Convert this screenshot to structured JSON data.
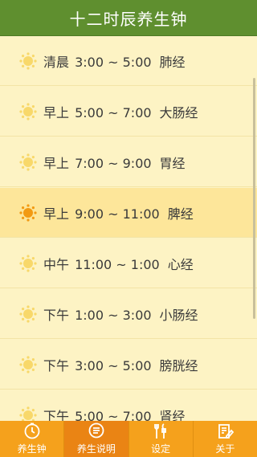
{
  "header": {
    "title": "十二时辰养生钟"
  },
  "list": {
    "items": [
      {
        "period": "清晨",
        "time": "3:00 ~ 5:00",
        "organ": "肺经",
        "active": false
      },
      {
        "period": "早上",
        "time": "5:00 ~ 7:00",
        "organ": "大肠经",
        "active": false
      },
      {
        "period": "早上",
        "time": "7:00 ~ 9:00",
        "organ": "胃经",
        "active": false
      },
      {
        "period": "早上",
        "time": "9:00 ~ 11:00",
        "organ": "脾经",
        "active": true
      },
      {
        "period": "中午",
        "time": "11:00 ~ 1:00",
        "organ": "心经",
        "active": false
      },
      {
        "period": "下午",
        "time": "1:00 ~ 3:00",
        "organ": "小肠经",
        "active": false
      },
      {
        "period": "下午",
        "time": "3:00 ~ 5:00",
        "organ": "膀胱经",
        "active": false
      },
      {
        "period": "下午",
        "time": "5:00 ~ 7:00",
        "organ": "肾经",
        "active": false
      }
    ],
    "icon": "sun-icon"
  },
  "tabs": [
    {
      "label": "养生钟",
      "icon": "clock-icon",
      "selected": false
    },
    {
      "label": "养生说明",
      "icon": "list-bubble-icon",
      "selected": true
    },
    {
      "label": "设定",
      "icon": "tools-icon",
      "selected": false
    },
    {
      "label": "关于",
      "icon": "document-edit-icon",
      "selected": false
    }
  ],
  "colors": {
    "title_bar": "#5f8f2f",
    "background": "#fdf3c4",
    "active_row": "#fde69a",
    "sun_light": "#f8d86a",
    "sun_active": "#f29a12",
    "tab_bar": "#f5a11c",
    "tab_selected": "#ea8414"
  }
}
